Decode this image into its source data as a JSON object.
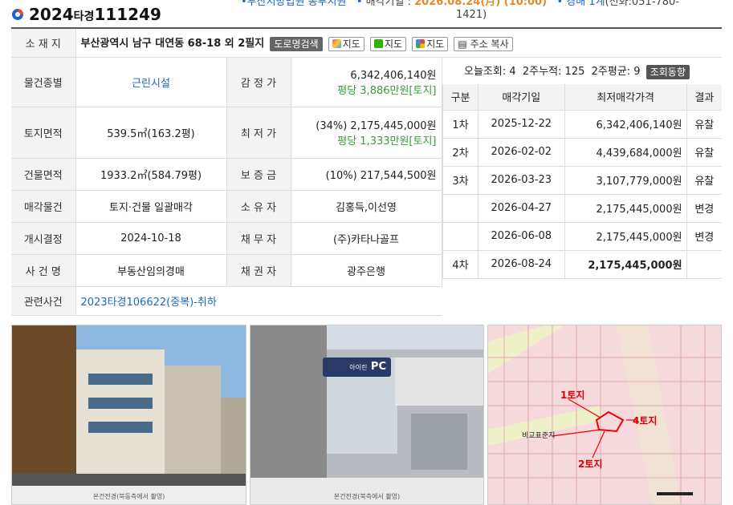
{
  "header": {
    "case_year": "2024",
    "case_type": "타경",
    "case_num": "111249",
    "court": "부산지방법원 동부지원",
    "auction_date_label": "매각기일 :",
    "auction_date": "2026.08.24(月) (10:00)",
    "dept": "경매 1계",
    "phone": "(전화:051-780-",
    "phone2": "1421)"
  },
  "address": {
    "label": "소 재 지",
    "value": "부산광역시 남구 대연동 68-18 외 2필지",
    "road_btn": "도로명검색",
    "map1": "지도",
    "map2": "지도",
    "map3": "지도",
    "copy_btn": "주소 복사"
  },
  "rows": {
    "type_label": "물건종별",
    "type_value": "근린시설",
    "appraisal_label": "감 정 가",
    "appraisal_value": "6,342,406,140원",
    "appraisal_sub": "평당 3,886만원[토지]",
    "land_label": "토지면적",
    "land_value": "539.5㎡(163.2평)",
    "min_label": "최 저 가",
    "min_value": "(34%) 2,175,445,000원",
    "min_sub": "평당 1,333만원[토지]",
    "bldg_label": "건물면적",
    "bldg_value": "1933.2㎡(584.79평)",
    "deposit_label": "보 증 금",
    "deposit_value": "(10%) 217,544,500원",
    "sale_label": "매각물건",
    "sale_value": "토지·건물 일괄매각",
    "owner_label": "소 유 자",
    "owner_value": "김홍득,이선영",
    "start_label": "개시결정",
    "start_value": "2024-10-18",
    "debtor_label": "채 무 자",
    "debtor_value": "(주)카타나골프",
    "case_label": "사 건 명",
    "case_value": "부동산임의경매",
    "creditor_label": "채 권 자",
    "creditor_value": "광주은행",
    "related_label": "관련사건",
    "related_value": "2023타경106622(중복)-취하"
  },
  "views": {
    "today": "오늘조회: 4",
    "two_week": "2주누적: 125",
    "avg": "2주평균: 9",
    "btn": "조회동향"
  },
  "history": {
    "headers": [
      "구분",
      "매각기일",
      "최저매각가격",
      "결과"
    ],
    "rows": [
      [
        "1차",
        "2025-12-22",
        "6,342,406,140원",
        "유찰"
      ],
      [
        "2차",
        "2026-02-02",
        "4,439,684,000원",
        "유찰"
      ],
      [
        "3차",
        "2026-03-23",
        "3,107,779,000원",
        "유찰"
      ],
      [
        "",
        "2026-04-27",
        "2,175,445,000원",
        "변경"
      ],
      [
        "",
        "2026-06-08",
        "2,175,445,000원",
        "변경"
      ],
      [
        "4차",
        "2026-08-24",
        "2,175,445,000원",
        ""
      ]
    ]
  },
  "photos": {
    "cap1": "본건전경(북동측에서 촬영)",
    "cap2": "본건전경(북측에서 촬영)",
    "map_label1": "1토지",
    "map_label2": "2토지",
    "map_label4": "4토지",
    "map_std": "비교표준지",
    "building_sign": "PC",
    "building_sign_small": "아이린"
  },
  "colors": {
    "accent": "#1d66c8",
    "orange": "#e8862a",
    "green": "#3a9a3a"
  }
}
